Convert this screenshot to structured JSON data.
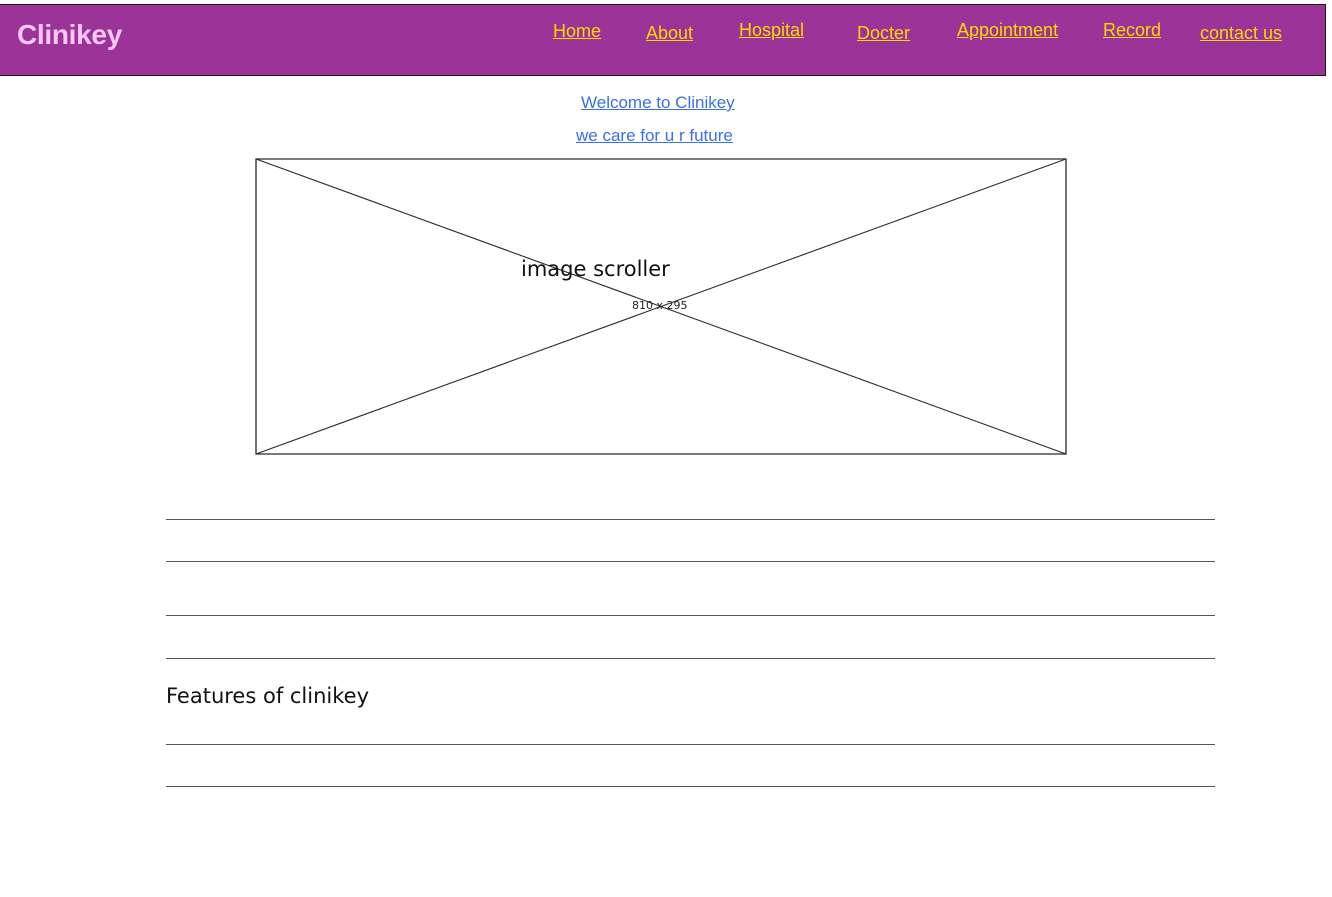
{
  "header": {
    "brand": "Clinikey",
    "nav": {
      "home": "Home",
      "about": "About",
      "hospital": "Hospital",
      "docter": "Docter",
      "appointment": "Appointment",
      "record": "Record",
      "contact": "contact us"
    }
  },
  "welcome": {
    "line1": "Welcome to Clinikey",
    "line2": "we care for u r future"
  },
  "image_scroller": {
    "label": "image scroller",
    "size": "810 x 295"
  },
  "features": {
    "heading": "Features of clinikey"
  },
  "colors": {
    "header_bg": "#9b3399",
    "brand_text": "#f7c8f3",
    "nav_link": "#ffd800",
    "welcome_link": "#3a6fe8"
  }
}
